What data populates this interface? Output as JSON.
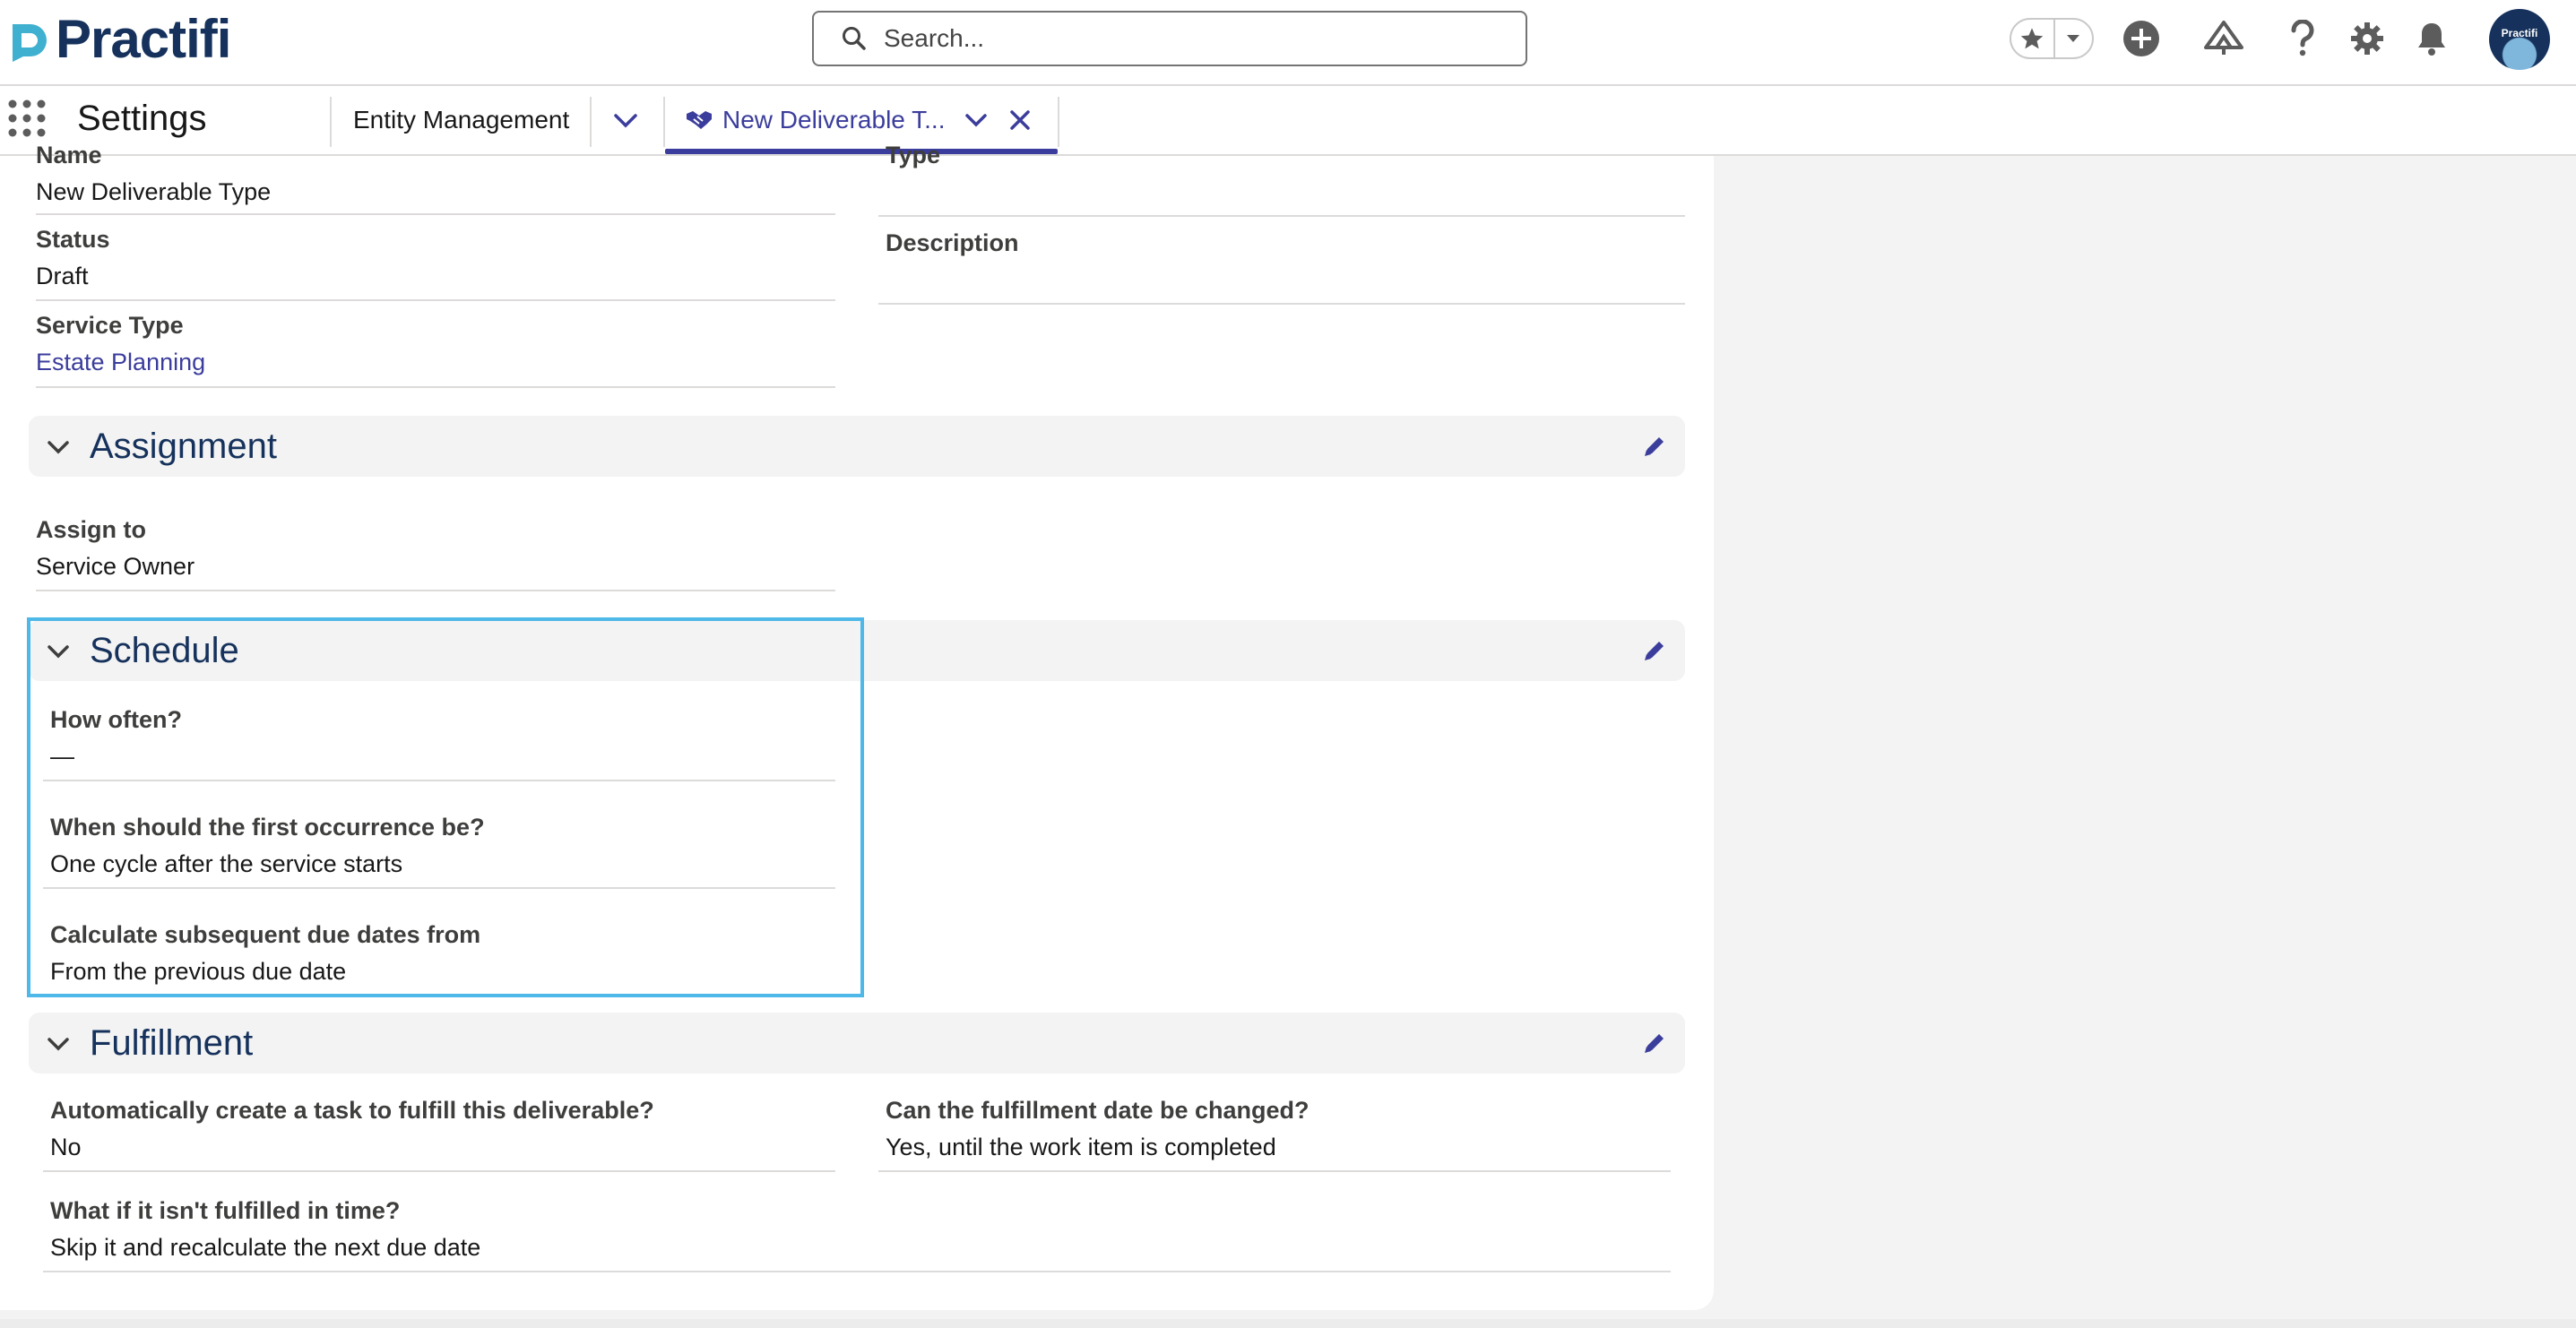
{
  "header": {
    "logo_text": "Practifi",
    "search_placeholder": "Search...",
    "avatar_text": "Practifi",
    "icons": [
      "star-icon",
      "chevron-down-icon",
      "add-icon",
      "trailhead-icon",
      "help-icon",
      "setup-gear-icon",
      "notification-bell-icon"
    ],
    "brand_color": "#16325c",
    "accent_color": "#3b3d9c"
  },
  "nav": {
    "app_name": "Settings",
    "tabs": [
      {
        "label": "Entity Management"
      },
      {
        "label": "New Deliverable T...",
        "active": true
      }
    ]
  },
  "record": {
    "fields_top": {
      "name_label": "Name",
      "name_value": "New Deliverable Type",
      "type_label": "Type",
      "type_value": "",
      "status_label": "Status",
      "status_value": "Draft",
      "description_label": "Description",
      "description_value": "",
      "service_type_label": "Service Type",
      "service_type_value": "Estate Planning"
    },
    "sections": {
      "assignment": {
        "title": "Assignment",
        "assign_to_label": "Assign to",
        "assign_to_value": "Service Owner"
      },
      "schedule": {
        "title": "Schedule",
        "how_often_label": "How often?",
        "how_often_value": "—",
        "first_occurrence_label": "When should the first occurrence be?",
        "first_occurrence_value": "One cycle after the service starts",
        "subsequent_label": "Calculate subsequent due dates from",
        "subsequent_value": "From the previous due date"
      },
      "fulfillment": {
        "title": "Fulfillment",
        "auto_task_label": "Automatically create a task to fulfill this deliverable?",
        "auto_task_value": "No",
        "date_change_label": "Can the fulfillment date be changed?",
        "date_change_value": "Yes, until the work item is completed",
        "not_fulfilled_label": "What if it isn't fulfilled in time?",
        "not_fulfilled_value": "Skip it and recalculate the next due date"
      }
    }
  }
}
